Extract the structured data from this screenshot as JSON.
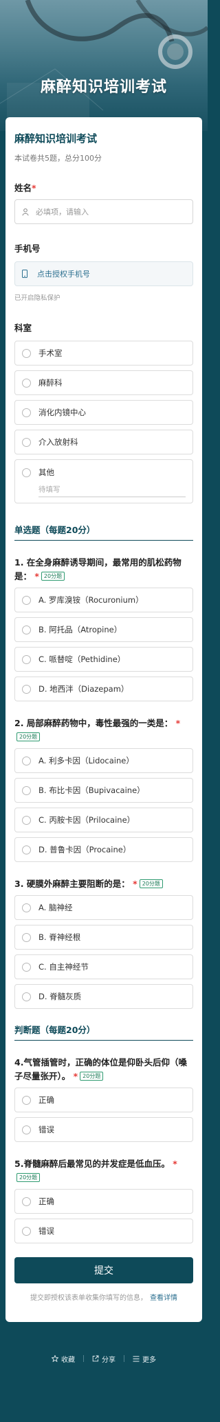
{
  "hero": {
    "title": "麻醉知识培训考试"
  },
  "form": {
    "title": "麻醉知识培训考试",
    "description": "本试卷共5题，总分100分"
  },
  "name_field": {
    "label": "姓名",
    "required_mark": "*",
    "placeholder": "必填项，请输入"
  },
  "phone_field": {
    "label": "手机号",
    "button": "点击授权手机号",
    "privacy": "已开启隐私保护"
  },
  "department": {
    "label": "科室",
    "options": [
      "手术室",
      "麻醉科",
      "消化内镜中心",
      "介入放射科"
    ],
    "other_label": "其他",
    "other_placeholder": "待填写"
  },
  "section_single": {
    "title": "单选题（每题20分）"
  },
  "q1": {
    "title": "1. 在全身麻醉诱导期间，最常用的肌松药物是：",
    "score": "20分题",
    "options": [
      "A. 罗库溴铵（Rocuronium）",
      "B. 阿托品（Atropine）",
      "C. 哌替啶（Pethidine）",
      "D. 地西泮（Diazepam）"
    ]
  },
  "q2": {
    "title": "2. 局部麻醉药物中，毒性最强的一类是：",
    "score": "20分题",
    "options": [
      "A. 利多卡因（Lidocaine）",
      "B. 布比卡因（Bupivacaine）",
      "C. 丙胺卡因（Prilocaine）",
      "D. 普鲁卡因（Procaine）"
    ]
  },
  "q3": {
    "title": "3. 硬膜外麻醉主要阻断的是：",
    "score": "20分题",
    "options": [
      "A. 脑神经",
      "B. 脊神经根",
      "C. 自主神经节",
      "D. 脊髓灰质"
    ]
  },
  "section_judge": {
    "title": "判断题（每题20分）"
  },
  "q4": {
    "title": "4.气管插管时，正确的体位是仰卧头后仰（嗓子尽量张开）。",
    "score": "20分题",
    "options": [
      "正确",
      "错误"
    ]
  },
  "q5": {
    "title": "5.脊髓麻醉后最常见的并发症是低血压。",
    "score": "20分题",
    "options": [
      "正确",
      "错误"
    ]
  },
  "submit": {
    "label": "提交",
    "notice": "提交即授权该表单收集你填写的信息，",
    "notice_link": "查看详情"
  },
  "footer": {
    "favorite": "收藏",
    "share": "分享",
    "more": "更多"
  },
  "colors": {
    "primary": "#0e4a59",
    "required": "#e53935",
    "tag": "#1a7a56",
    "link": "#2b6f8f"
  },
  "icons": {
    "name_field": "person-icon",
    "phone_field": "phone-icon",
    "favorite": "star-icon",
    "share": "share-icon",
    "more": "menu-icon"
  }
}
